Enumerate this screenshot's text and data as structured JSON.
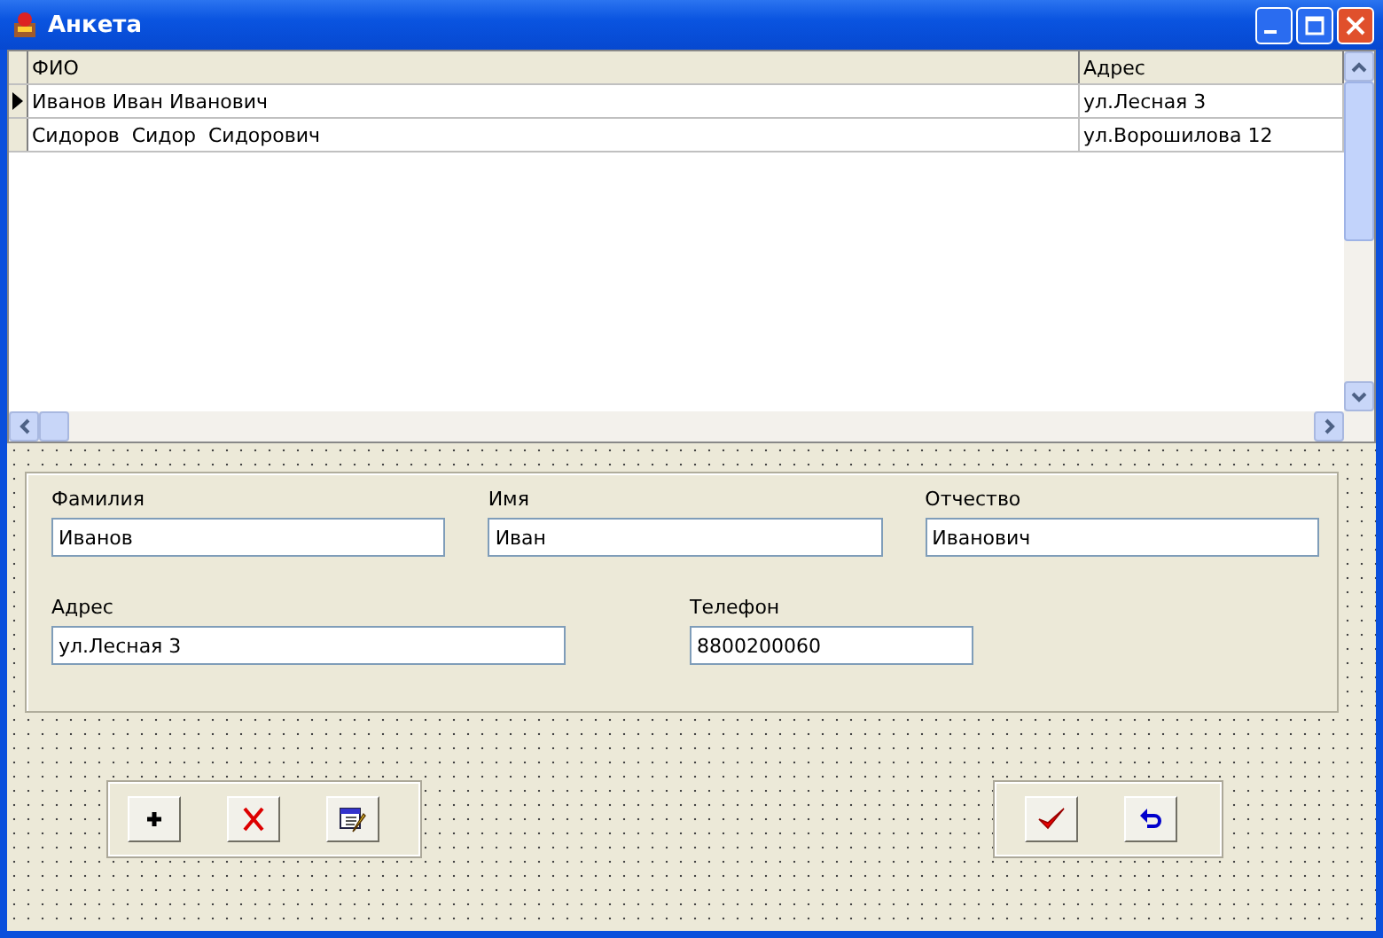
{
  "window": {
    "title": "Анкета"
  },
  "table": {
    "columns": [
      "ФИО",
      "Адрес"
    ],
    "rows": [
      {
        "cells": [
          "Иванов Иван Иванович",
          "ул.Лесная 3"
        ],
        "selected": true
      },
      {
        "cells": [
          "Сидоров  Сидор  Сидорович",
          "ул.Ворошилова 12"
        ],
        "selected": false
      }
    ]
  },
  "form": {
    "fields": [
      {
        "label": "Фамилия",
        "value": "Иванов"
      },
      {
        "label": "Имя",
        "value": "Иван"
      },
      {
        "label": "Отчество",
        "value": "Иванович"
      },
      {
        "label": "Адрес",
        "value": "ул.Лесная 3"
      },
      {
        "label": "Телефон",
        "value": "8800200060"
      }
    ]
  },
  "left_buttons": [
    {
      "kind": "add"
    },
    {
      "kind": "delete"
    },
    {
      "kind": "edit"
    }
  ],
  "right_buttons": [
    {
      "kind": "confirm"
    },
    {
      "kind": "undo"
    }
  ]
}
